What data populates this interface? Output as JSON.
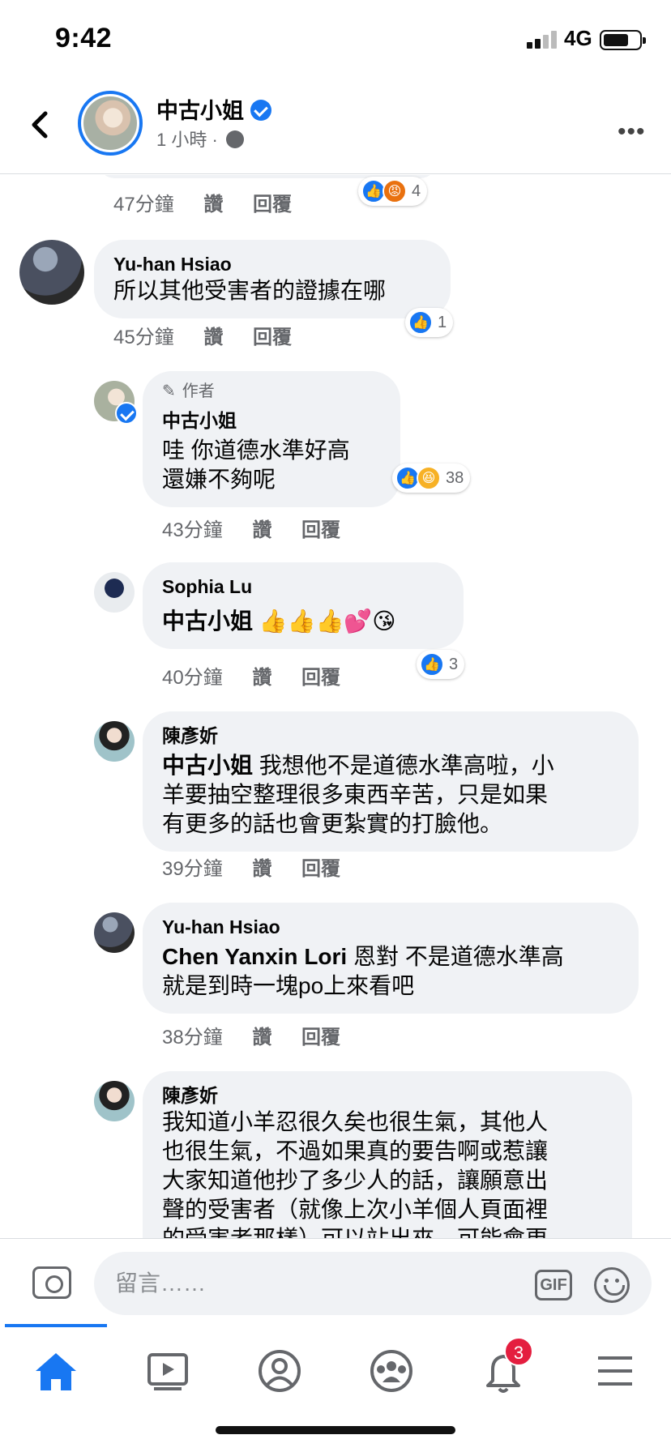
{
  "status": {
    "time": "9:42",
    "network": "4G"
  },
  "post_header": {
    "name": "中古小姐",
    "time": "1 小時",
    "separator": "·"
  },
  "comments": [
    {
      "time": "47分鐘",
      "like": "讚",
      "reply": "回覆",
      "reaction_count": "4"
    },
    {
      "author": "Yu-han Hsiao",
      "text": "所以其他受害者的證據在哪",
      "time": "45分鐘",
      "like": "讚",
      "reply": "回覆",
      "reaction_count": "1"
    },
    {
      "badge": "作者",
      "author": "中古小姐",
      "text_line1": "哇 你道德水準好高",
      "text_line2": "還嫌不夠呢",
      "time": "43分鐘",
      "like": "讚",
      "reply": "回覆",
      "reaction_count": "38"
    },
    {
      "author": "Sophia Lu",
      "mention": "中古小姐",
      "emoji": "👍👍👍💕😘",
      "time": "40分鐘",
      "like": "讚",
      "reply": "回覆",
      "reaction_count": "3"
    },
    {
      "author": "陳彥妡",
      "mention": "中古小姐",
      "text_line1": " 我想他不是道德水準高啦，小",
      "text_line2": "羊要抽空整理很多東西辛苦，只是如果",
      "text_line3": "有更多的話也會更紮實的打臉他。",
      "time": "39分鐘",
      "like": "讚",
      "reply": "回覆"
    },
    {
      "author": "Yu-han Hsiao",
      "mention": "Chen Yanxin Lori",
      "text_line1": " 恩對 不是道德水準高",
      "text_line2": "就是到時一塊po上來看吧",
      "time": "38分鐘",
      "like": "讚",
      "reply": "回覆"
    },
    {
      "author": "陳彥妡",
      "text_line1": "我知道小羊忍很久矣也很生氣，其他人",
      "text_line2": "也很生氣，不過如果真的要告啊或惹讓",
      "text_line3": "大家知道他抄了多少人的話，讓願意出",
      "text_line4": "聲的受害者（就像上次小羊個人頁面裡",
      "text_line5": "的受害者那樣）可以站出來，可能會更"
    }
  ],
  "composer": {
    "placeholder": "留言……",
    "gif_label": "GIF"
  },
  "tabbar": {
    "notifications_badge": "3"
  },
  "colors": {
    "accent": "#1877f2",
    "bubble": "#f0f2f5",
    "badge": "#e41e3f"
  }
}
